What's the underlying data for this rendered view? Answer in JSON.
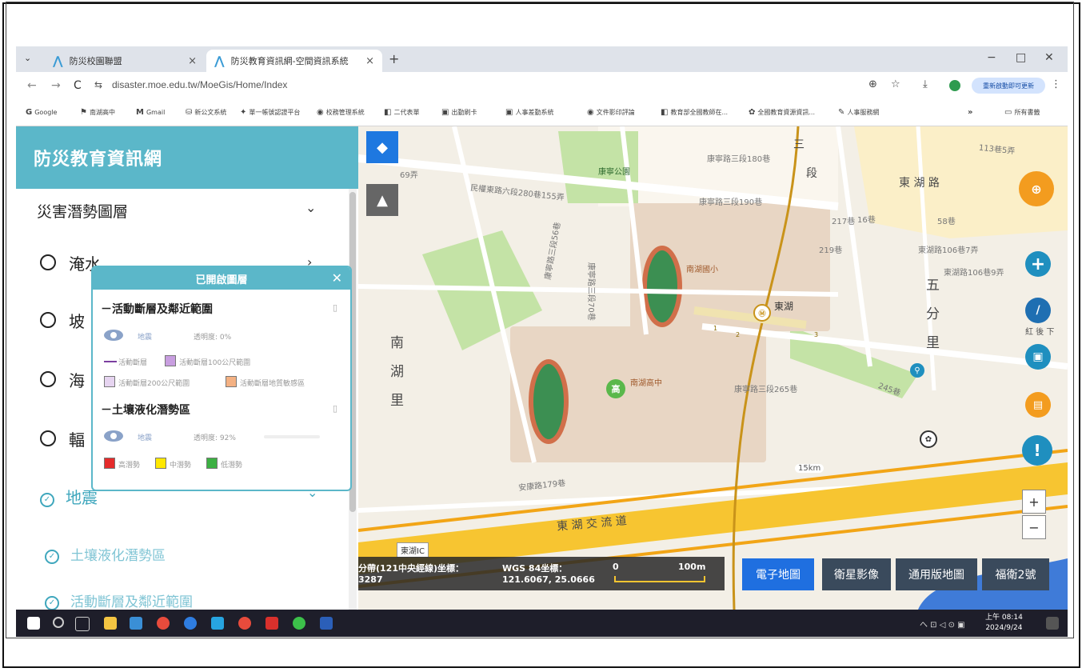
{
  "browser": {
    "tabs": [
      {
        "label": "防災校園聯盟",
        "close": "×"
      },
      {
        "label": "防災教育資訊網-空間資訊系統",
        "close": "×"
      }
    ],
    "tab_dropdown": "⌄",
    "new_tab": "+",
    "window_controls": [
      "−",
      "□",
      "✕"
    ],
    "nav": {
      "back": "←",
      "forward": "→",
      "reload": "C",
      "site_info": "⇆"
    },
    "url": "disaster.moe.edu.tw/MoeGis/Home/Index",
    "update_button": "重新啟動即可更新"
  },
  "bookmarks": [
    {
      "icon": "G",
      "label": "Google"
    },
    {
      "icon": "⚑",
      "label": "南湖高中"
    },
    {
      "icon": "M",
      "label": "Gmail"
    },
    {
      "icon": "⛁",
      "label": "新公文系統"
    },
    {
      "icon": "✦",
      "label": "單一帳號認證平台"
    },
    {
      "icon": "◉",
      "label": "校務管理系統"
    },
    {
      "icon": "◧",
      "label": "二代表單"
    },
    {
      "icon": "▣",
      "label": "出勤刷卡"
    },
    {
      "icon": "▣",
      "label": "人事差勤系統"
    },
    {
      "icon": "◉",
      "label": "文件影印評論"
    },
    {
      "icon": "◧",
      "label": "教育部全國教師在..."
    },
    {
      "icon": "✿",
      "label": "全國教育資源資訊..."
    },
    {
      "icon": "✎",
      "label": "人事服務網"
    },
    {
      "icon": "»",
      "label": ""
    },
    {
      "icon": "▭",
      "label": "所有書籤"
    }
  ],
  "sidebar": {
    "title": "防災教育資訊網",
    "section": "災害潛勢圖層",
    "items": [
      {
        "label": "淹水"
      },
      {
        "label": "坡"
      },
      {
        "label": "海"
      },
      {
        "label": "輻"
      }
    ],
    "checked": [
      {
        "label": "地震"
      },
      {
        "label": "土壤液化潛勢區"
      },
      {
        "label": "活動斷層及鄰近範圍"
      }
    ]
  },
  "layer_popup": {
    "title": "已開啟圖層",
    "close": "✕",
    "groups": [
      {
        "name": "－活動斷層及鄰近範圍",
        "type_label": "地震",
        "opacity": "透明度: 0%",
        "legend": [
          {
            "label": "活動斷層",
            "color": "#7b3fa0"
          },
          {
            "label": "活動斷層100公尺範圍",
            "color": "#c89ee0"
          },
          {
            "label": "活動斷層200公尺範圍",
            "color": "#e6d4f0"
          },
          {
            "label": "活動斷層地質敏感區",
            "color": "#f4b183"
          }
        ]
      },
      {
        "name": "－土壤液化潛勢區",
        "type_label": "地震",
        "opacity": "透明度: 92%",
        "legend": [
          {
            "label": "高潛勢",
            "color": "#e52b2b"
          },
          {
            "label": "中潛勢",
            "color": "#ffe800"
          },
          {
            "label": "低潛勢",
            "color": "#3cb043"
          }
        ]
      }
    ]
  },
  "map": {
    "labels": {
      "road1": "康寧路三段180巷",
      "road2": "康寧路三段190巷",
      "road3": "民權東路六段280巷155弄",
      "road4": "康寧路三段70巷",
      "road5": "康寧路三段56巷",
      "road6": "康寧路三段265巷",
      "road7": "安康路179巷",
      "road8": "東湖路106巷7弄",
      "road9": "東湖路106巷9弄",
      "road10": "217巷",
      "road11": "219巷",
      "road12": "113巷5弄",
      "road13": "245巷",
      "road14": "58巷",
      "road15": "16巷",
      "road16": "69弄",
      "park": "康寧公園",
      "school1": "南湖國小",
      "school2": "南湖高中",
      "dist1": [
        "南",
        "湖",
        "里"
      ],
      "dist2": [
        "五",
        "分",
        "里"
      ],
      "road_donghu": "東 湖 路",
      "highway": "東 湖 交 流 道",
      "station": "東湖",
      "ic": "東湖IC",
      "km": "15km",
      "mrt_num": [
        "1",
        "2",
        "3"
      ],
      "school_badge": "高",
      "road_san": "三",
      "road_duan": "段",
      "edge_text": "紅 後 下"
    },
    "coords": {
      "twd_label": "分帶(121中央經線)坐標：",
      "twd_value": "3287",
      "wgs_label": "WGS 84坐標：",
      "wgs_value": "121.6067, 25.0666",
      "scale_start": "0",
      "scale_end": "100m"
    },
    "map_types": [
      {
        "label": "電子地圖",
        "active": true
      },
      {
        "label": "衛星影像",
        "active": false
      },
      {
        "label": "通用版地圖",
        "active": false
      },
      {
        "label": "福衛2號",
        "active": false
      }
    ],
    "zoom_in": "+",
    "zoom_out": "−"
  },
  "taskbar": {
    "time": "上午 08:14",
    "date": "2024/9/24",
    "tray": "へ ⊡ ◁ ⊙ ▣"
  },
  "colors": {
    "brand": "#5bb7c9",
    "map_type_active": "#1f6fe0",
    "road_highway": "#f7c531",
    "park": "#c4e3a6",
    "school": "#e8d6c4"
  }
}
